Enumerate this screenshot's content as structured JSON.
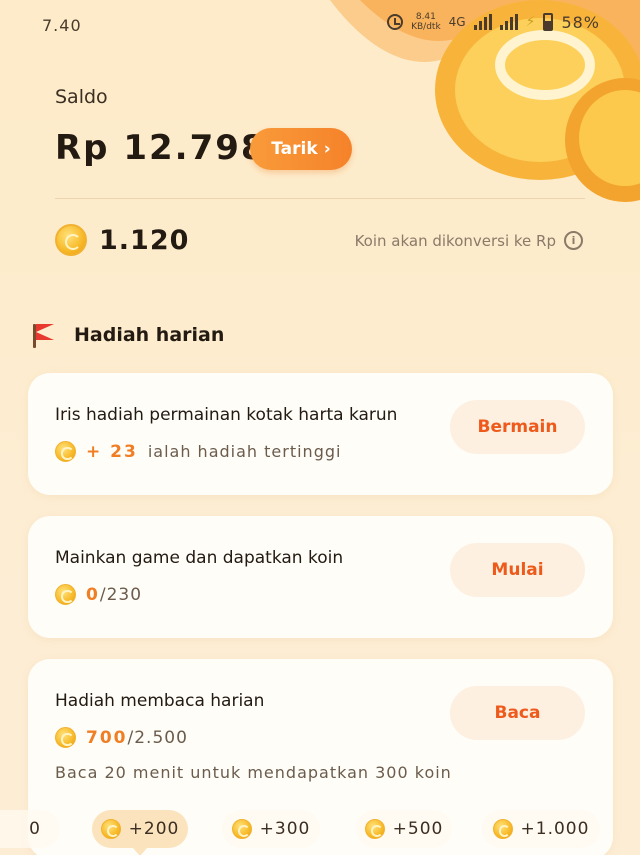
{
  "status_bar": {
    "time": "7.40",
    "speed_value": "8.41",
    "speed_unit": "KB/dtk",
    "network": "4G",
    "battery": "58%"
  },
  "balance": {
    "label": "Saldo",
    "amount": "Rp 12.798",
    "withdraw_label": "Tarik",
    "coins": "1.120",
    "convert_note": "Koin akan dikonversi ke Rp"
  },
  "daily": {
    "title": "Hadiah harian",
    "tasks": [
      {
        "title": "Iris hadiah permainan kotak harta karun",
        "value": "+ 23",
        "suffix": "ialah hadiah tertinggi",
        "action": "Bermain"
      },
      {
        "title": "Mainkan game dan dapatkan koin",
        "value": "0",
        "suffix": "/230",
        "action": "Mulai"
      },
      {
        "title": "Hadiah membaca harian",
        "value": "700",
        "suffix": "/2.500",
        "note": "Baca 20 menit untuk mendapatkan 300 koin",
        "action": "Baca"
      }
    ],
    "milestones": [
      "0",
      "+200",
      "+300",
      "+500",
      "+1.000"
    ]
  },
  "colors": {
    "accent": "#f5822a",
    "action_text": "#ee5a1c",
    "coin": "#f7b928"
  }
}
